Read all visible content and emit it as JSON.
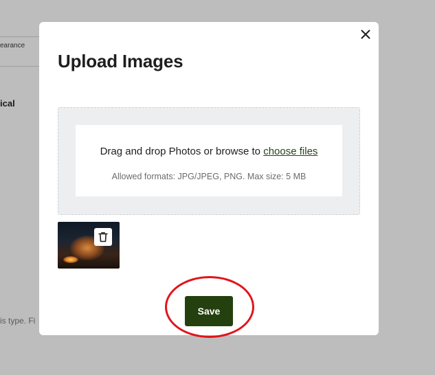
{
  "background": {
    "tab_fragment": "earance",
    "heading_fragment": "ical",
    "note_fragment": "is type. Fi"
  },
  "modal": {
    "title": "Upload Images",
    "close_icon": "close-icon",
    "dropzone": {
      "text": "Drag and drop Photos or browse to ",
      "link": "choose files",
      "formats": "Allowed formats: JPG/JPEG, PNG. Max size: 5 MB"
    },
    "thumbnail": {
      "delete_icon": "trash-icon"
    },
    "save_label": "Save"
  },
  "colors": {
    "primary": "#24400f",
    "highlight": "#e0141b",
    "overlay": "#bdbdbd"
  }
}
